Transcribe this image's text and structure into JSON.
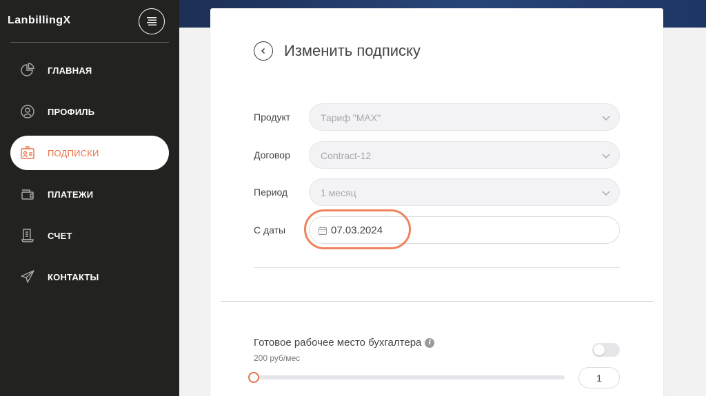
{
  "app": {
    "title": "LanbillingX"
  },
  "sidebar": {
    "items": [
      {
        "label": "ГЛАВНАЯ",
        "icon": "pie-chart-icon",
        "active": false
      },
      {
        "label": "ПРОФИЛЬ",
        "icon": "user-icon",
        "active": false
      },
      {
        "label": "ПОДПИСКИ",
        "icon": "id-card-icon",
        "active": true
      },
      {
        "label": "ПЛАТЕЖИ",
        "icon": "wallet-icon",
        "active": false
      },
      {
        "label": "СЧЕТ",
        "icon": "receipt-icon",
        "active": false
      },
      {
        "label": "КОНТАКТЫ",
        "icon": "paper-plane-icon",
        "active": false
      }
    ]
  },
  "page": {
    "title": "Изменить подписку"
  },
  "form": {
    "product": {
      "label": "Продукт",
      "value": "Тариф \"MAX\""
    },
    "contract": {
      "label": "Договор",
      "value": "Contract-12"
    },
    "period": {
      "label": "Период",
      "value": "1 месяц"
    },
    "start_date": {
      "label": "С даты",
      "value": "07.03.2024"
    }
  },
  "option": {
    "title": "Готовое рабочее место бухгалтера",
    "price": "200 руб/мес",
    "enabled": false,
    "quantity": "1",
    "slider_fraction": 0
  },
  "colors": {
    "accent": "#e8734a",
    "sidebar_bg": "#222220",
    "topbar": "#233c6b"
  }
}
